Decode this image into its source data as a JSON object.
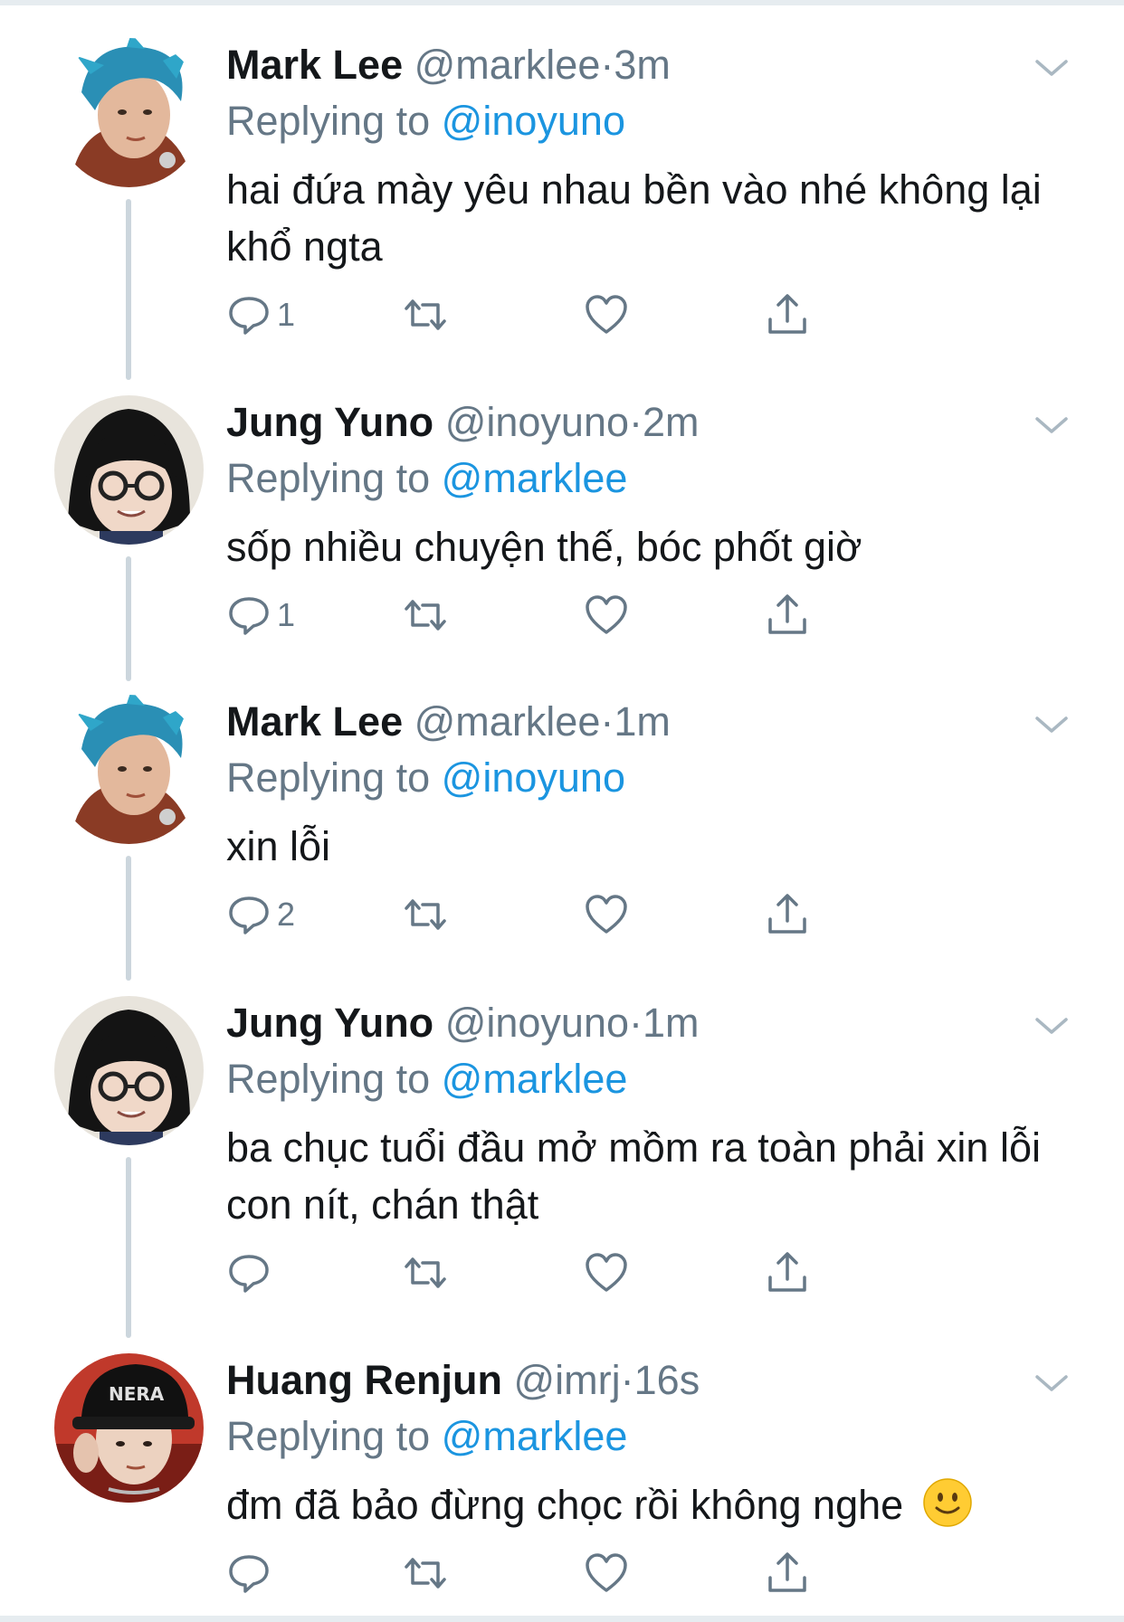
{
  "tweets": [
    {
      "name": "Mark Lee",
      "handle": "@marklee",
      "time": "3m",
      "replying_prefix": "Replying to",
      "replying_to": "@inoyuno",
      "text": "hai đứa mày yêu nhau bền vào nhé không lại khổ ngta",
      "reply_count": "1",
      "avatar": "blue-hair-avatar"
    },
    {
      "name": "Jung Yuno",
      "handle": "@inoyuno",
      "time": "2m",
      "replying_prefix": "Replying to",
      "replying_to": "@marklee",
      "text": "sốp nhiều chuyện thế, bóc phốt giờ",
      "reply_count": "1",
      "avatar": "glasses-avatar"
    },
    {
      "name": "Mark Lee",
      "handle": "@marklee",
      "time": "1m",
      "replying_prefix": "Replying to",
      "replying_to": "@inoyuno",
      "text": "xin lỗi",
      "reply_count": "2",
      "avatar": "blue-hair-avatar"
    },
    {
      "name": "Jung Yuno",
      "handle": "@inoyuno",
      "time": "1m",
      "replying_prefix": "Replying to",
      "replying_to": "@marklee",
      "text": "ba chục tuổi đầu mở mồm ra toàn phải xin lỗi con nít, chán thật",
      "reply_count": "",
      "avatar": "glasses-avatar"
    },
    {
      "name": "Huang Renjun",
      "handle": "@imrj",
      "time": "16s",
      "replying_prefix": "Replying to",
      "replying_to": "@marklee",
      "text": "đm đã bảo đừng chọc rồi không nghe",
      "reply_count": "",
      "avatar": "cap-avatar",
      "emoji": "slightly-smiling-face"
    }
  ],
  "separator": "·",
  "colors": {
    "text": "#14171a",
    "secondary": "#657786",
    "link": "#1b95e0",
    "thread_line": "#ccd6dd",
    "border": "#e6ecf0"
  },
  "icons": [
    "reply-icon",
    "retweet-icon",
    "like-icon",
    "share-icon",
    "chevron-down-icon"
  ]
}
